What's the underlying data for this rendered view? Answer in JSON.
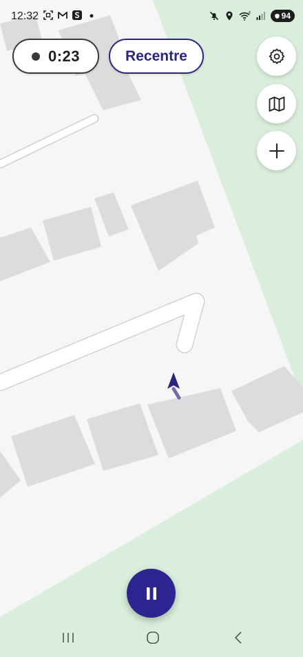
{
  "status_bar": {
    "time": "12:32",
    "left_icons": [
      "screenshot-icon",
      "gmail-icon",
      "s-app-icon",
      "notification-dot-icon"
    ],
    "right_icons": [
      "mute-icon",
      "location-icon",
      "wifi-icon",
      "signal-icon"
    ],
    "battery_level": "94"
  },
  "recording": {
    "elapsed": "0:23"
  },
  "recentre_button": {
    "label": "Recentre"
  },
  "side_buttons": [
    "gear-icon",
    "map-icon",
    "plus-icon"
  ],
  "pause_button": {
    "icon": "pause-icon"
  },
  "navigation_bar": {
    "buttons": [
      "recent-apps-icon",
      "home-icon",
      "back-icon"
    ]
  },
  "colors": {
    "accent": "#2e2490",
    "map_background": "#f6f6f6",
    "green_area": "#d9eedb",
    "building": "#dcdcdc",
    "road": "#ffffff",
    "location_marker": "#2a2580"
  }
}
